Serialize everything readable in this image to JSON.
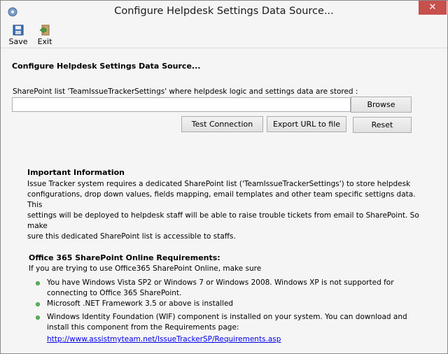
{
  "window": {
    "title": "Configure Helpdesk Settings Data Source...",
    "close_label": "✕"
  },
  "toolbar": {
    "save_label": "Save",
    "exit_label": "Exit"
  },
  "main": {
    "heading": "Configure Helpdesk Settings Data Source...",
    "url_label": "SharePoint list 'TeamIssueTrackerSettings' where helpdesk logic and settings data are stored :",
    "url_value": "",
    "browse_label": "Browse",
    "test_label": "Test Connection",
    "export_label": "Export URL to file",
    "reset_label": "Reset"
  },
  "info": {
    "title": "Important Information",
    "lines": [
      "Issue Tracker system requires a dedicated SharePoint list ('TeamIssueTrackerSettings') to store helpdesk",
      "configurations, drop down values, fields mapping, email templates and other team specific settigns data. This",
      "settings will be deployed to helpdesk staff will be able to raise trouble tickets from email to SharePoint. So make",
      "sure this dedicated SharePoint list is accessible to staffs."
    ]
  },
  "requirements": {
    "title": "Office 365 SharePoint Online Requirements:",
    "subtitle": "If you are trying to use Office365 SharePoint Online, make sure",
    "items": [
      {
        "line1": "You have Windows Vista SP2 or Windows 7 or Windows 2008. Windows XP is not supported for",
        "line2": "connecting to Office 365 SharePoint."
      },
      {
        "line1": "Microsoft .NET Framework 3.5 or above is installed",
        "line2": ""
      },
      {
        "line1": "Windows Identity Foundation (WIF) component is installed on your system. You can download and",
        "line2": "install this component from the Requirements page:"
      }
    ],
    "link": "http://www.assistmyteam.net/IssueTrackerSP/Requirements.asp"
  },
  "colors": {
    "close_button": "#c7504c",
    "bullet": "#5cb85c",
    "link": "#0000ee"
  }
}
